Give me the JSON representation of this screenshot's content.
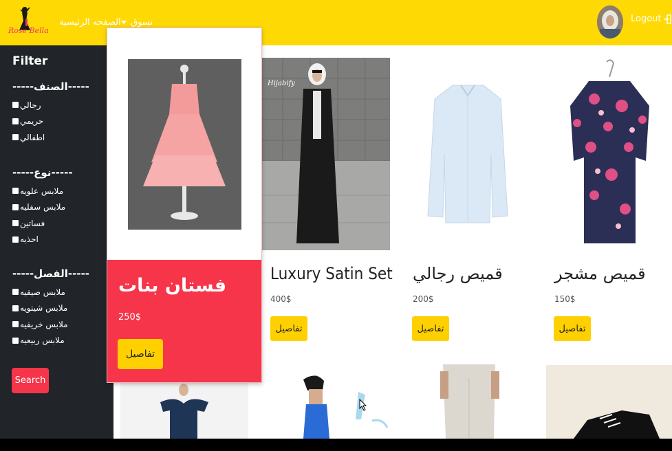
{
  "navbar": {
    "logo_text": "Rose Bella",
    "home_label": "الصفحه الرئيسية",
    "shop_label": "تسوق",
    "logout_label": "Logout"
  },
  "sidebar": {
    "title": "Filter",
    "sections": [
      {
        "heading": "-----الصنف-----",
        "items": [
          "رجالي",
          "حريمي",
          "اطفالي"
        ]
      },
      {
        "heading": "-----نوع-----",
        "items": [
          "ملابس علويه",
          "ملابس سفليه",
          "فساتين",
          "احذيه"
        ]
      },
      {
        "heading": "-----الفصل-----",
        "items": [
          "ملابس صيفيه",
          "ملابس شيتويه",
          "ملابس خريفيه",
          "ملابس ربيعيه"
        ]
      }
    ],
    "search_label": "Search"
  },
  "highlight": {
    "title": "فستان بنات",
    "price": "250$",
    "button": "تفاصيل"
  },
  "products": [
    {
      "title": "Luxury Satin Set",
      "price": "400$",
      "button": "تفاصيل",
      "watermark": "Hijabify"
    },
    {
      "title": "قميص رجالي",
      "price": "200$",
      "button": "تفاصيل"
    },
    {
      "title": "قميص مشجر",
      "price": "150$",
      "button": "تفاصيل"
    }
  ],
  "colors": {
    "navbar": "#ffd904",
    "sidebar": "#212529",
    "accent_red": "#f6354a",
    "button_yellow": "#ffd000"
  }
}
